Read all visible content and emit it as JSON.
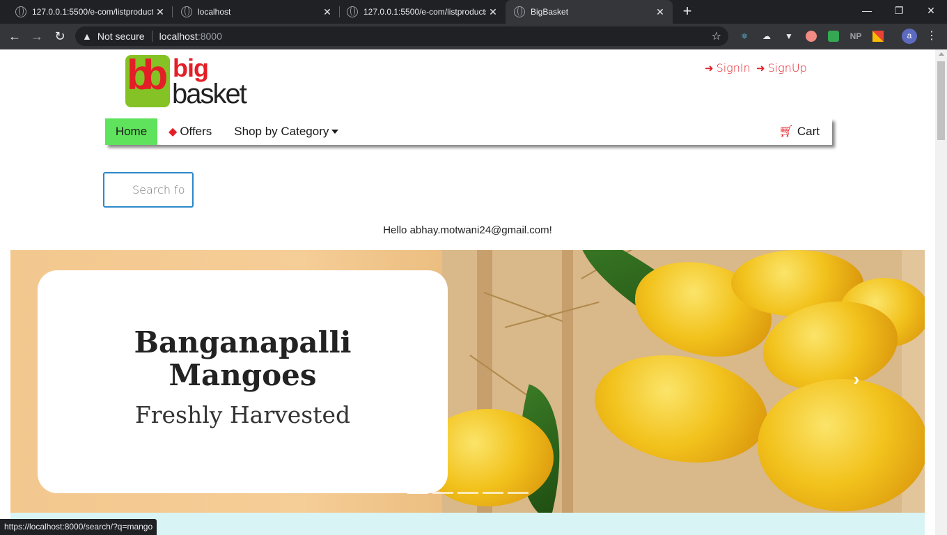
{
  "browser": {
    "tabs": [
      {
        "title": "127.0.0.1:5500/e-com/listproducts",
        "active": false
      },
      {
        "title": "localhost",
        "active": false
      },
      {
        "title": "127.0.0.1:5500/e-com/listproducts",
        "active": false
      },
      {
        "title": "BigBasket",
        "active": true
      }
    ],
    "new_tab": "+",
    "security_label": "Not secure",
    "url_host": "localhost",
    "url_port": ":8000",
    "extensions": [
      "react-devtools-icon",
      "cloud-icon",
      "vue-devtools-icon",
      "record-icon",
      "extension-icon",
      "NP",
      "color-icon"
    ],
    "ext_np_label": "NP",
    "profile_initial": "a",
    "status_url": "https://localhost:8000/search/?q=mango"
  },
  "site": {
    "logo": {
      "mark": "bb",
      "word1": "big",
      "word2": "basket"
    },
    "auth": {
      "signin": "SignIn",
      "signup": "SignUp"
    },
    "nav": {
      "home": "Home",
      "offers": "Offers",
      "category": "Shop by Category",
      "cart": "Cart"
    },
    "search": {
      "placeholder": "Search fo"
    },
    "greeting": "Hello abhay.motwani24@gmail.com!",
    "banner": {
      "title_line1": "Banganapalli",
      "title_line2": "Mangoes",
      "subtitle": "Freshly Harvested",
      "next_arrow": "›",
      "slides": 5,
      "active_slide": 0
    }
  },
  "colors": {
    "brand_red": "#e41e26",
    "brand_green": "#84c225",
    "home_active": "#5fe25c",
    "search_border": "#2b87c9"
  }
}
